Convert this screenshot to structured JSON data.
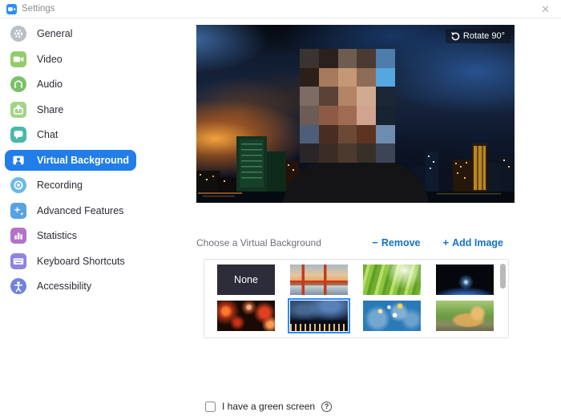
{
  "window": {
    "title": "Settings",
    "close_glyph": "✕"
  },
  "sidebar": {
    "selected_color": "#217de8",
    "items": [
      {
        "label": "General",
        "icon": "gear-icon",
        "selected": false
      },
      {
        "label": "Video",
        "icon": "video-camera-icon",
        "selected": false
      },
      {
        "label": "Audio",
        "icon": "headphones-icon",
        "selected": false
      },
      {
        "label": "Share",
        "icon": "share-screen-icon",
        "selected": false
      },
      {
        "label": "Chat",
        "icon": "chat-bubble-icon",
        "selected": false
      },
      {
        "label": "Virtual Background",
        "icon": "virtual-background-icon",
        "selected": true
      },
      {
        "label": "Recording",
        "icon": "record-icon",
        "selected": false
      },
      {
        "label": "Advanced Features",
        "icon": "sparkles-icon",
        "selected": false
      },
      {
        "label": "Statistics",
        "icon": "bar-chart-icon",
        "selected": false
      },
      {
        "label": "Keyboard Shortcuts",
        "icon": "keyboard-icon",
        "selected": false
      },
      {
        "label": "Accessibility",
        "icon": "person-icon",
        "selected": false
      }
    ]
  },
  "preview": {
    "rotate_button": "Rotate 90°",
    "mosaic": {
      "cols": 5,
      "rows": 6,
      "colors": [
        "#3b3330",
        "#2a211d",
        "#6e5c51",
        "#4a3a31",
        "#4e7dab",
        "#2b1f1a",
        "#a77a5e",
        "#c49776",
        "#8e6c57",
        "#55a7e0",
        "#7d6c63",
        "#5c4136",
        "#b28566",
        "#d0ab92",
        "#1b2734",
        "#6d5c55",
        "#8c5a45",
        "#a06b53",
        "#d2a38f",
        "#172330",
        "#4d5e78",
        "#4a2d22",
        "#6b4936",
        "#5d3322",
        "#6e8cb0",
        "#2a2527",
        "#3b2d26",
        "#4c3a2f",
        "#363029",
        "#3c4556"
      ]
    }
  },
  "chooser": {
    "title": "Choose a Virtual Background",
    "remove_glyph": "−",
    "remove_label": "Remove",
    "add_glyph": "+",
    "add_label": "Add Image",
    "accent_color": "#1372c8",
    "thumbnails": [
      {
        "name": "none",
        "label": "None",
        "selected": false
      },
      {
        "name": "golden-gate-bridge",
        "selected": false
      },
      {
        "name": "grass",
        "selected": false
      },
      {
        "name": "earth-from-space",
        "selected": false
      },
      {
        "name": "night-lantern-alley",
        "selected": false
      },
      {
        "name": "city-skyline-night",
        "selected": true
      },
      {
        "name": "world-map-blue",
        "selected": false
      },
      {
        "name": "doge-park",
        "selected": false
      }
    ]
  },
  "footer": {
    "green_screen_label": "I have a green screen",
    "help_glyph": "?",
    "checked": false
  }
}
